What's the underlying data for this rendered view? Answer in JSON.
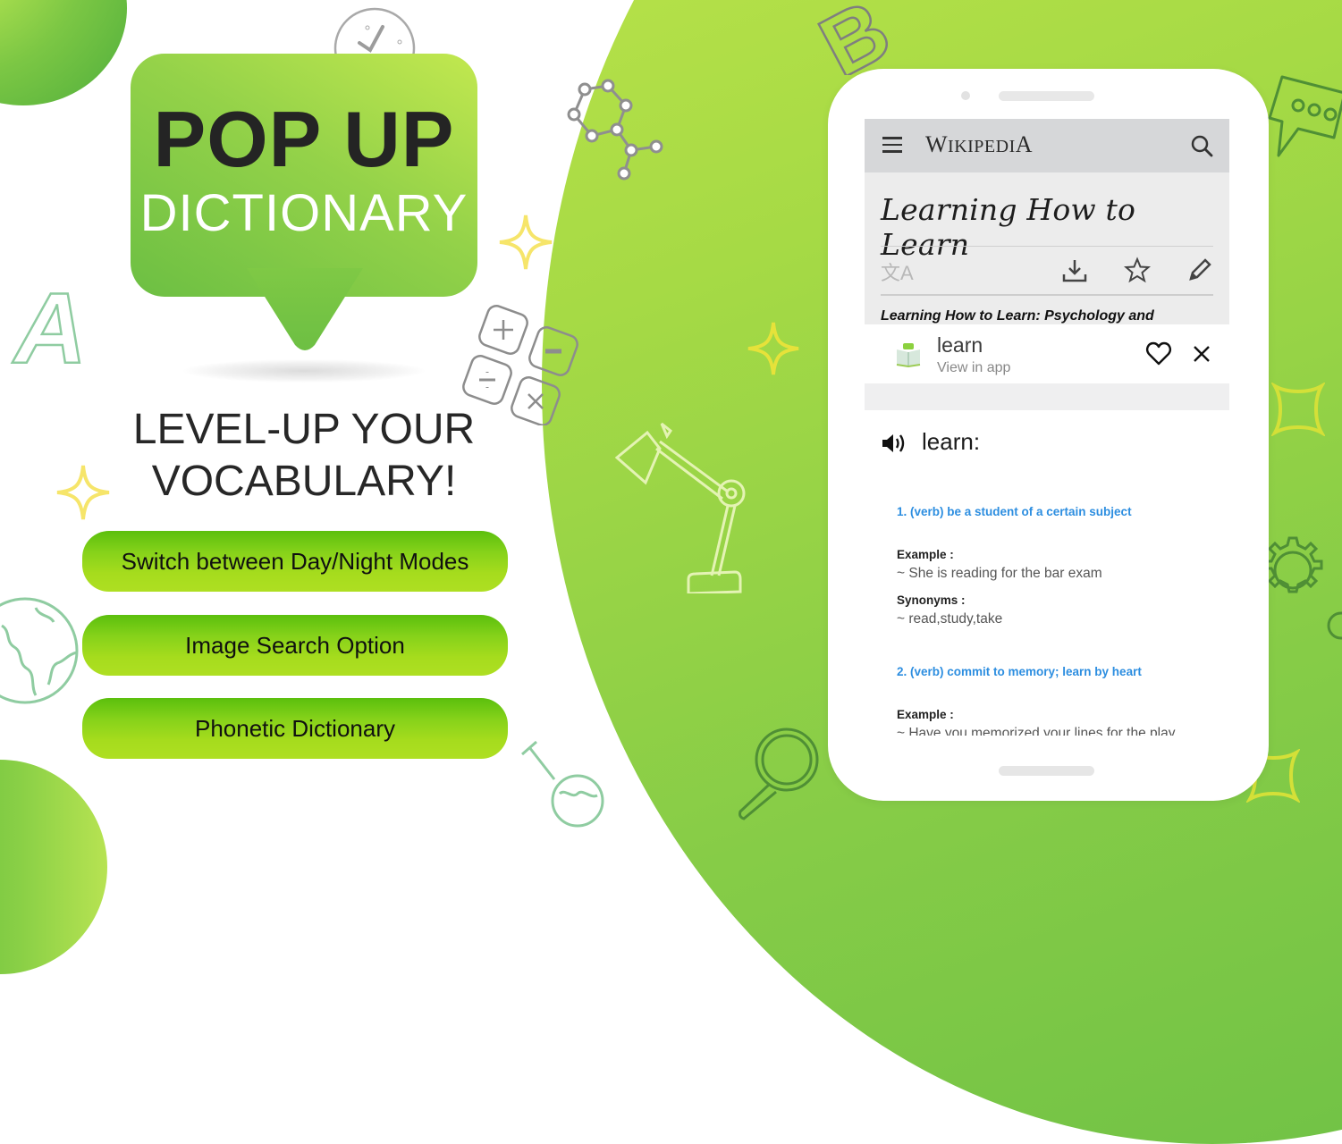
{
  "promo": {
    "title_line1": "POP UP",
    "title_line2": "DICTIONARY",
    "tagline_line1": "LEVEL-UP YOUR",
    "tagline_line2": "VOCABULARY!",
    "features": [
      "Switch between Day/Night Modes",
      "Image Search Option",
      "Phonetic Dictionary"
    ]
  },
  "colors": {
    "brand_green": "#8ccf47",
    "pill_green_top": "#5bbf0d",
    "pill_green_bottom": "#aedf22",
    "title_dark": "#242424",
    "link_blue": "#2d8ee0",
    "sparkle_yellow": "#f6e56a"
  },
  "phone": {
    "wiki_header": {
      "menu_icon": "hamburger-menu-icon",
      "logo_W": "W",
      "logo_ikipedi": "IKIPEDI",
      "logo_A": "A",
      "search_icon": "search-icon"
    },
    "article": {
      "title": "Learning How to Learn",
      "translate_icon": "文A",
      "actions": [
        "download-icon",
        "star-icon",
        "edit-icon"
      ],
      "lead_text": "Learning How to Learn: Psychology and"
    },
    "popup": {
      "word": "learn",
      "subtitle": "View in app",
      "favorite_icon": "heart-icon",
      "close_icon": "close-icon"
    },
    "definition": {
      "headword": "learn:",
      "senses": [
        {
          "definition": "1. (verb) be a student of a certain subject",
          "example_label": "Example :",
          "example": "~ She is reading for the bar exam",
          "synonyms_label": "Synonyms :",
          "synonyms": "~ read,study,take"
        },
        {
          "definition": "2. (verb) commit to memory; learn by heart",
          "example_label": "Example :",
          "example": "~ Have you memorized your lines for the play"
        }
      ]
    }
  }
}
